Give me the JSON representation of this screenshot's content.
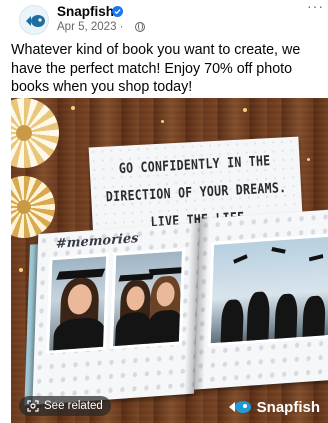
{
  "post": {
    "page_name": "Snapfish",
    "date": "Apr 5, 2023",
    "meta_separator": "·",
    "more_label": "···",
    "caption": "Whatever kind of book you want to create, we have the perfect match! Enjoy 70% off photo books when you shop today!"
  },
  "media": {
    "quote_lines": [
      "GO CONFIDENTLY IN THE",
      "DIRECTION OF YOUR DREAMS.",
      "LIVE THE LIFE"
    ],
    "book_title": "#memories",
    "see_related_label": "See related",
    "brand_label": "Snapfish"
  },
  "colors": {
    "verified": "#1877f2",
    "meta_gray": "#65676b",
    "brand_accent": "#1e9bd7"
  },
  "icons": {
    "avatar": "fish-logo-icon",
    "verified": "verified-badge-icon",
    "audience": "globe-icon",
    "see_related": "lens-search-icon",
    "brand": "fish-logo-icon"
  }
}
